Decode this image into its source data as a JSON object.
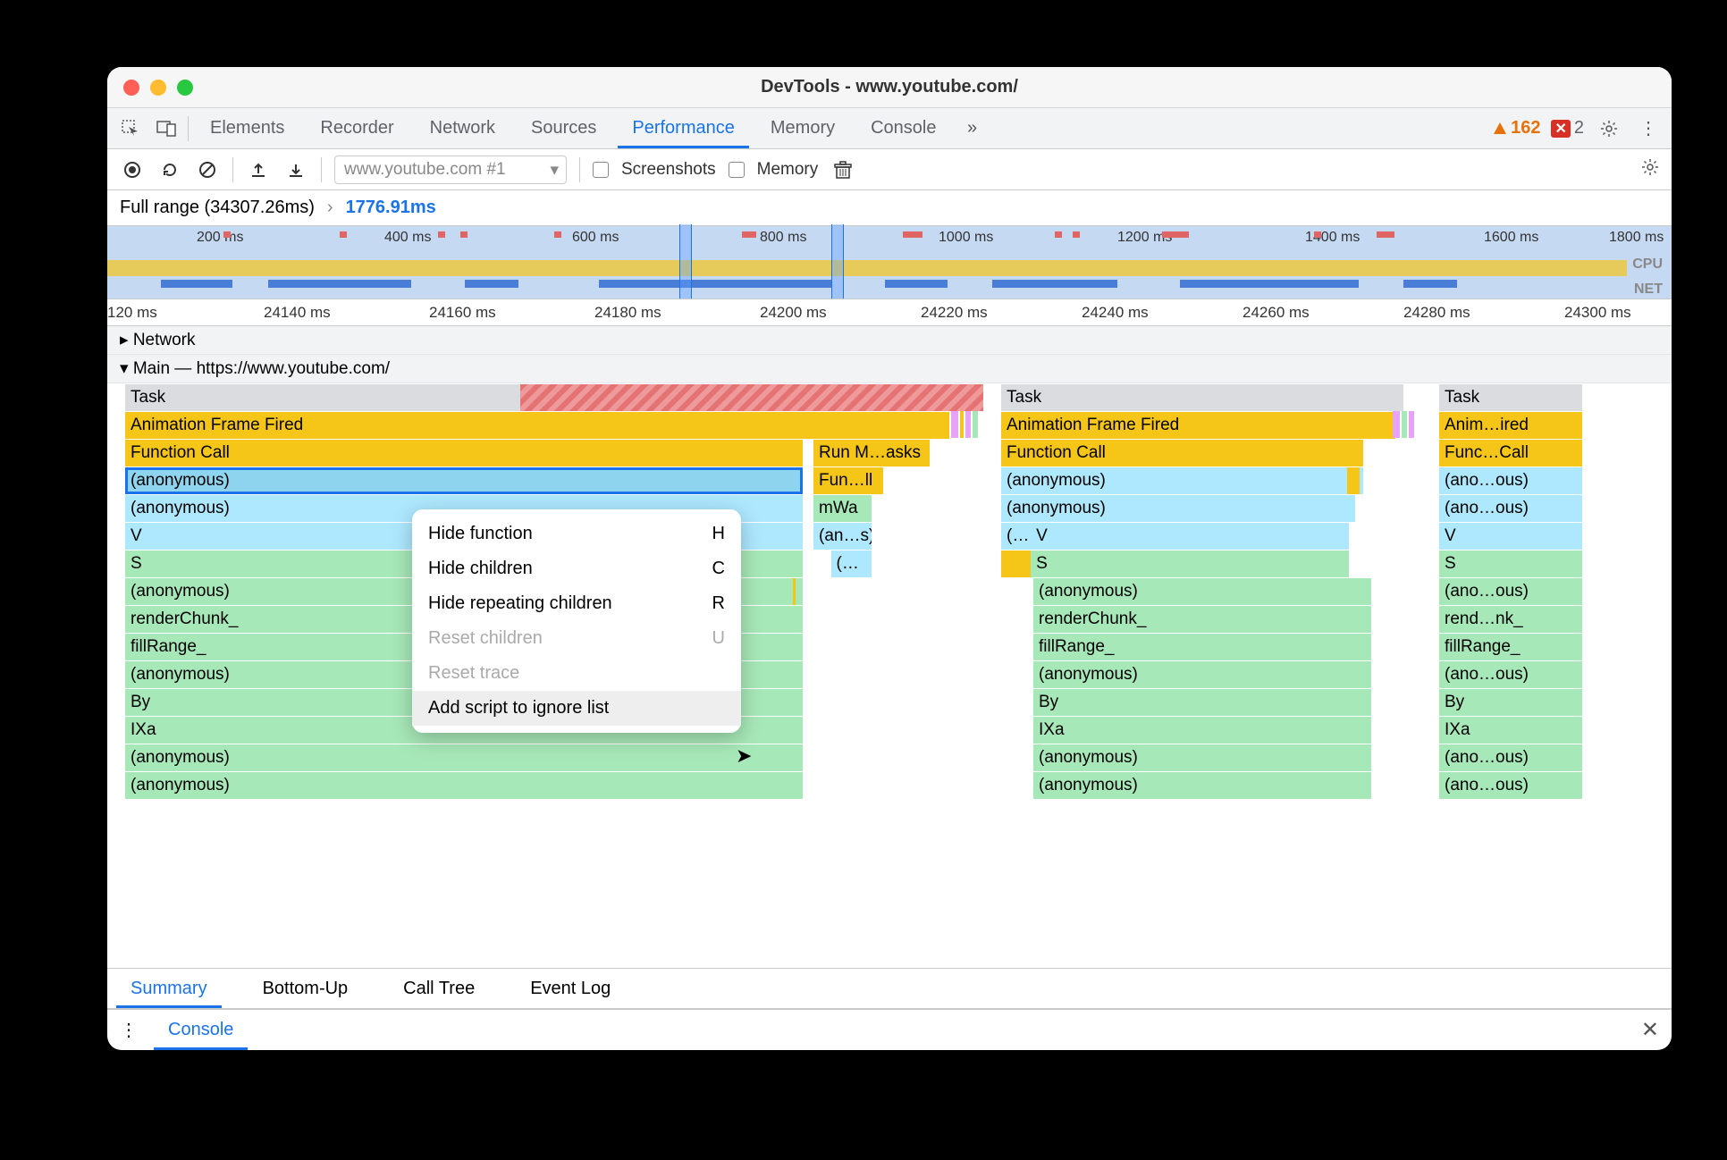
{
  "window": {
    "title": "DevTools - www.youtube.com/"
  },
  "tabs": [
    "Elements",
    "Recorder",
    "Network",
    "Sources",
    "Performance",
    "Memory",
    "Console"
  ],
  "active_tab": "Performance",
  "warnings": "162",
  "errors": "2",
  "toolbar": {
    "recording_dropdown": "www.youtube.com #1",
    "screenshots_label": "Screenshots",
    "memory_label": "Memory"
  },
  "breadcrumb": {
    "root": "Full range (34307.26ms)",
    "sep": "›",
    "current": "1776.91ms"
  },
  "overview": {
    "ticks": [
      "200 ms",
      "400 ms",
      "600 ms",
      "800 ms",
      "1000 ms",
      "1200 ms",
      "1400 ms",
      "1600 ms",
      "1800 ms"
    ],
    "cpu": "CPU",
    "net": "NET"
  },
  "ruler": [
    "120 ms",
    "24140 ms",
    "24160 ms",
    "24180 ms",
    "24200 ms",
    "24220 ms",
    "24240 ms",
    "24260 ms",
    "24280 ms",
    "24300 ms"
  ],
  "tracks": {
    "network": "Network",
    "main": "Main — https://www.youtube.com/",
    "rows": [
      "Task",
      "Animation Frame Fired",
      "Function Call",
      "(anonymous)",
      "(anonymous)",
      "V",
      "S",
      "(anonymous)",
      "renderChunk_",
      "fillRange_",
      "(anonymous)",
      "By",
      "IXa",
      "(anonymous)",
      "(anonymous)"
    ],
    "col2_small": [
      "",
      "",
      "Run M…asks",
      "Fun…ll",
      "mWa",
      "(an…s)",
      "(…"
    ],
    "col3": [
      "Task",
      "Animation Frame Fired",
      "Function Call",
      "(anonymous)",
      "(anonymous)",
      "(…",
      "V",
      "S",
      "(anonymous)",
      "renderChunk_",
      "fillRange_",
      "(anonymous)",
      "By",
      "IXa",
      "(anonymous)",
      "(anonymous)"
    ],
    "col4": [
      "Task",
      "Anim…ired",
      "Func…Call",
      "(ano…ous)",
      "(ano…ous)",
      "V",
      "S",
      "(ano…ous)",
      "rend…nk_",
      "fillRange_",
      "(ano…ous)",
      "By",
      "IXa",
      "(ano…ous)",
      "(ano…ous)"
    ]
  },
  "context_menu": [
    {
      "label": "Hide function",
      "key": "H",
      "disabled": false
    },
    {
      "label": "Hide children",
      "key": "C",
      "disabled": false
    },
    {
      "label": "Hide repeating children",
      "key": "R",
      "disabled": false
    },
    {
      "label": "Reset children",
      "key": "U",
      "disabled": true
    },
    {
      "label": "Reset trace",
      "key": "",
      "disabled": true
    },
    {
      "label": "Add script to ignore list",
      "key": "",
      "disabled": false,
      "hover": true
    }
  ],
  "details_tabs": [
    "Summary",
    "Bottom-Up",
    "Call Tree",
    "Event Log"
  ],
  "active_details_tab": "Summary",
  "drawer_tab": "Console"
}
